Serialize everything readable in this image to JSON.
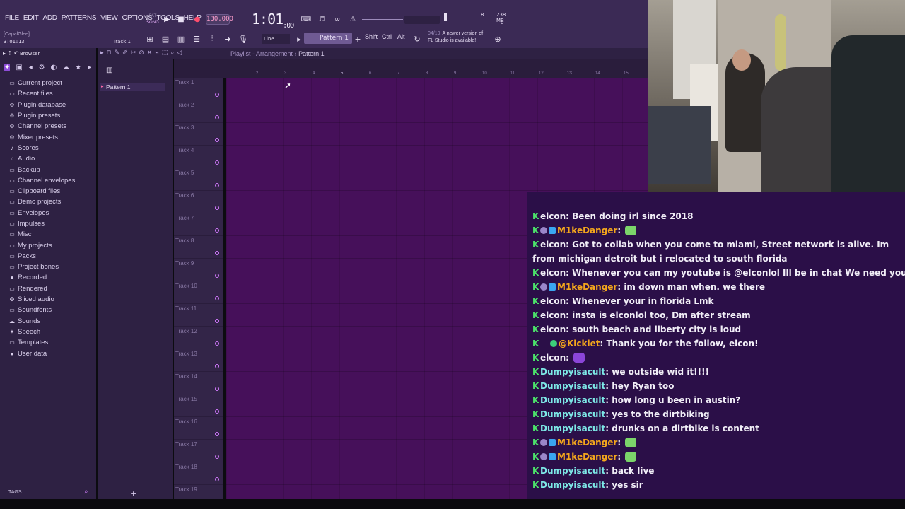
{
  "menu": [
    "FILE",
    "EDIT",
    "ADD",
    "PATTERNS",
    "VIEW",
    "OPTIONS",
    "TOOLS",
    "HELP"
  ],
  "transport": {
    "mode_pat": "PAT",
    "mode_song": "SONG",
    "tempo": "130.000",
    "time_main": "1:01",
    "time_sub": ":00",
    "time_small": "3:01:13",
    "project_hint": "[CapalGlee]"
  },
  "meters": {
    "cpu": "8",
    "mem": "238 MB",
    "poly": "0"
  },
  "toolbar": {
    "snap": "Line",
    "pattern": "Pattern 1",
    "track_label": "Track 1",
    "modifiers": [
      "Shift",
      "Ctrl",
      "Alt"
    ],
    "news_date": "04/19",
    "news_text_1": "A newer version of",
    "news_text_2": "FL Studio is available!"
  },
  "browser": {
    "title": "Browser",
    "items": [
      {
        "label": "Current project",
        "icon": "folder-icon"
      },
      {
        "label": "Recent files",
        "icon": "folder-icon"
      },
      {
        "label": "Plugin database",
        "icon": "plug-icon"
      },
      {
        "label": "Plugin presets",
        "icon": "plug-icon"
      },
      {
        "label": "Channel presets",
        "icon": "plug-icon"
      },
      {
        "label": "Mixer presets",
        "icon": "plug-icon"
      },
      {
        "label": "Scores",
        "icon": "note-icon"
      },
      {
        "label": "Audio",
        "icon": "audio-icon"
      },
      {
        "label": "Backup",
        "icon": "folder-icon"
      },
      {
        "label": "Channel envelopes",
        "icon": "folder-icon"
      },
      {
        "label": "Clipboard files",
        "icon": "folder-icon"
      },
      {
        "label": "Demo projects",
        "icon": "folder-icon"
      },
      {
        "label": "Envelopes",
        "icon": "folder-icon"
      },
      {
        "label": "Impulses",
        "icon": "folder-icon"
      },
      {
        "label": "Misc",
        "icon": "folder-icon"
      },
      {
        "label": "My projects",
        "icon": "folder-icon"
      },
      {
        "label": "Packs",
        "icon": "folder-icon"
      },
      {
        "label": "Project bones",
        "icon": "folder-icon"
      },
      {
        "label": "Recorded",
        "icon": "mic-icon"
      },
      {
        "label": "Rendered",
        "icon": "folder-icon"
      },
      {
        "label": "Sliced audio",
        "icon": "slice-icon"
      },
      {
        "label": "Soundfonts",
        "icon": "folder-icon"
      },
      {
        "label": "Sounds",
        "icon": "cloud-icon"
      },
      {
        "label": "Speech",
        "icon": "speech-icon"
      },
      {
        "label": "Templates",
        "icon": "folder-icon"
      },
      {
        "label": "User data",
        "icon": "user-icon"
      }
    ],
    "tags_label": "TAGS"
  },
  "patterns": {
    "items": [
      "Pattern 1"
    ]
  },
  "playlist": {
    "title_prefix": "Playlist - Arrangement",
    "title_pattern": "Pattern 1",
    "bars": [
      "2",
      "3",
      "4",
      "5",
      "6",
      "7",
      "8",
      "9",
      "10",
      "11",
      "12",
      "13",
      "14",
      "15"
    ],
    "tracks": [
      "Track 1",
      "Track 2",
      "Track 3",
      "Track 4",
      "Track 5",
      "Track 6",
      "Track 7",
      "Track 8",
      "Track 9",
      "Track 10",
      "Track 11",
      "Track 12",
      "Track 13",
      "Track 14",
      "Track 15",
      "Track 16",
      "Track 17",
      "Track 18",
      "Track 19"
    ]
  },
  "chat": {
    "colors": {
      "elcon": "#f1eef7",
      "M1keDanger": "#f4a71c",
      "Kicklet": "#f4a71c",
      "Dumpyisacult": "#7de8e6",
      "kick": "#4be26a"
    },
    "messages": [
      {
        "user": "elcon",
        "text": ": Been doing irl since 2018",
        "badges": 0
      },
      {
        "user": "M1keDanger",
        "text": ":",
        "badges": 2,
        "emote": "green"
      },
      {
        "user": "elcon",
        "text": ": Got to collab when you come to miami, Street network is alive. Im from michigan detroit but i relocated to south florida",
        "badges": 0,
        "wrap": true
      },
      {
        "user": "elcon",
        "text": ": Whenever you can my youtube is @elconlol Ill be in chat We need you",
        "badges": 0
      },
      {
        "user": "M1keDanger",
        "text": ": im down man when. we there",
        "badges": 2
      },
      {
        "user": "elcon",
        "text": ": Whenever your in florida Lmk",
        "badges": 0
      },
      {
        "user": "elcon",
        "text": ": insta is elconlol too, Dm after stream",
        "badges": 0
      },
      {
        "user": "elcon",
        "text": ": south beach and liberty city is loud",
        "badges": 0
      },
      {
        "user": "@Kicklet",
        "text": ": Thank you for the follow, elcon!",
        "badges": 1
      },
      {
        "user": "elcon",
        "text": ":",
        "badges": 0,
        "emote": "purple"
      },
      {
        "user": "Dumpyisacult",
        "text": ": we outside wid it!!!!",
        "badges": 0
      },
      {
        "user": "Dumpyisacult",
        "text": ": hey Ryan too",
        "badges": 0
      },
      {
        "user": "Dumpyisacult",
        "text": ": how long u been in austin?",
        "badges": 0
      },
      {
        "user": "Dumpyisacult",
        "text": ": yes to the dirtbiking",
        "badges": 0
      },
      {
        "user": "Dumpyisacult",
        "text": ": drunks on a dirtbike is content",
        "badges": 0
      },
      {
        "user": "M1keDanger",
        "text": ":",
        "badges": 2,
        "emote": "green"
      },
      {
        "user": "M1keDanger",
        "text": ":",
        "badges": 2,
        "emote": "green"
      },
      {
        "user": "Dumpyisacult",
        "text": ": back live",
        "badges": 0
      },
      {
        "user": "Dumpyisacult",
        "text": ": yes sir",
        "badges": 0
      }
    ]
  }
}
